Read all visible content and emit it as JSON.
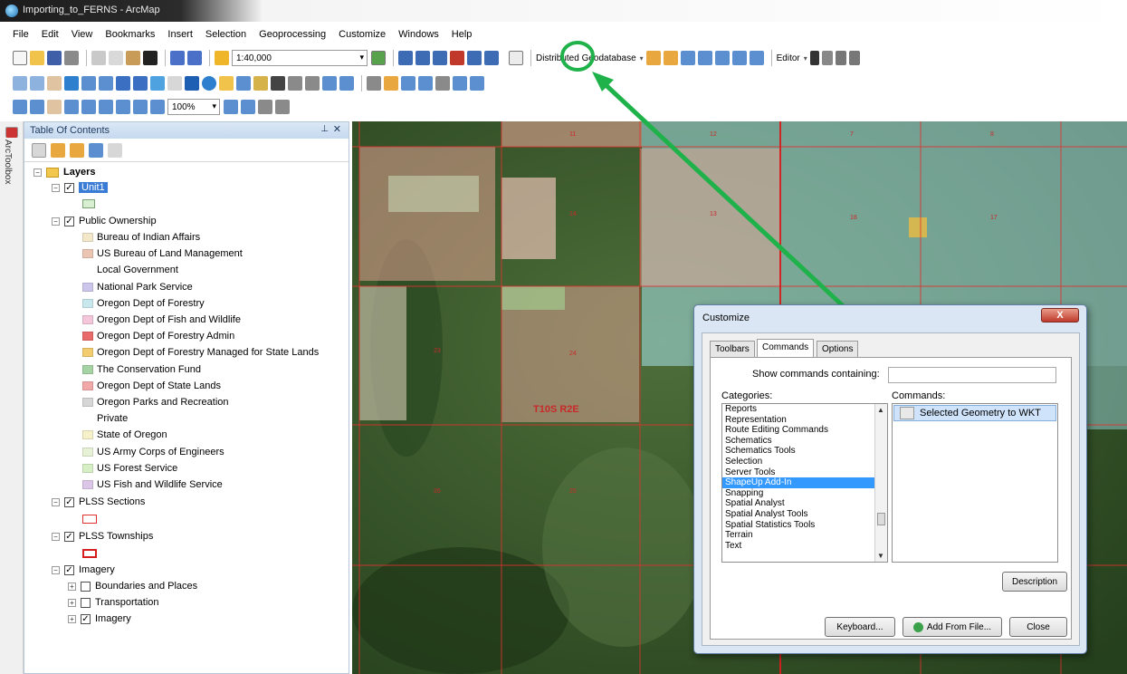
{
  "window": {
    "title": "Importing_to_FERNS - ArcMap"
  },
  "menu": [
    "File",
    "Edit",
    "View",
    "Bookmarks",
    "Insert",
    "Selection",
    "Geoprocessing",
    "Customize",
    "Windows",
    "Help"
  ],
  "toolbar": {
    "scale": "1:40,000",
    "distributed_geodatabase": "Distributed Geodatabase",
    "editor": "Editor",
    "layout_zoom": "100%"
  },
  "sidebar_strip": {
    "label": "ArcToolbox"
  },
  "toc": {
    "title": "Table Of Contents",
    "root": "Layers",
    "layers": [
      {
        "label": "Unit1",
        "selected": true
      },
      {
        "label": "Public Ownership"
      },
      {
        "label": "PLSS Sections"
      },
      {
        "label": "PLSS Townships"
      },
      {
        "label": "Imagery"
      }
    ],
    "public_ownership_classes": [
      {
        "label": "Bureau of Indian Affairs",
        "color": "#f3e7c9"
      },
      {
        "label": "US Bureau of Land Management",
        "color": "#ecc4b2"
      },
      {
        "label": "Local Government",
        "color": ""
      },
      {
        "label": "National Park Service",
        "color": "#cdc6ec"
      },
      {
        "label": "Oregon Dept of Forestry",
        "color": "#c9e8ee"
      },
      {
        "label": "Oregon Dept of Fish and Wildlife",
        "color": "#f3c6d9"
      },
      {
        "label": "Oregon Dept of Forestry Admin",
        "color": "#e86a6a"
      },
      {
        "label": "Oregon Dept of Forestry Managed for State Lands",
        "color": "#f2cc6e"
      },
      {
        "label": "The Conservation Fund",
        "color": "#a6d3a4"
      },
      {
        "label": "Oregon Dept of State Lands",
        "color": "#f2a8a8"
      },
      {
        "label": "Oregon Parks and Recreation",
        "color": "#d6d6d6"
      },
      {
        "label": "Private",
        "color": ""
      },
      {
        "label": "State of Oregon",
        "color": "#f6f1c8"
      },
      {
        "label": "US Army Corps of Engineers",
        "color": "#e7f1d6"
      },
      {
        "label": "US Forest Service",
        "color": "#d7efc4"
      },
      {
        "label": "US Fish and Wildlife Service",
        "color": "#dcc6e8"
      }
    ],
    "imagery_children": [
      {
        "label": "Boundaries and Places",
        "checked": false
      },
      {
        "label": "Transportation",
        "checked": false
      },
      {
        "label": "Imagery",
        "checked": true
      }
    ]
  },
  "map": {
    "township_label": "T10S R2E",
    "section_numbers": [
      "11",
      "12",
      "7",
      "8",
      "14",
      "13",
      "18",
      "17",
      "23",
      "24",
      "26",
      "25"
    ],
    "colors": {
      "blm": "#e3a393",
      "odf": "#a7e2ea",
      "line": "#e0312f",
      "forest": "#3a5a2d"
    }
  },
  "annotation": {
    "color": "#1fb24a"
  },
  "dialog": {
    "title": "Customize",
    "tabs": [
      "Toolbars",
      "Commands",
      "Options"
    ],
    "active_tab": "Commands",
    "show_label": "Show commands containing:",
    "show_value": "",
    "categories_label": "Categories:",
    "commands_label": "Commands:",
    "categories": [
      "Reports",
      "Representation",
      "Route Editing Commands",
      "Schematics",
      "Schematics Tools",
      "Selection",
      "Server Tools",
      "ShapeUp Add-In",
      "Snapping",
      "Spatial Analyst",
      "Spatial Analyst Tools",
      "Spatial Statistics Tools",
      "Terrain",
      "Text"
    ],
    "selected_category": "ShapeUp Add-In",
    "commands": [
      "Selected Geometry to WKT"
    ],
    "buttons": {
      "description": "Description",
      "keyboard": "Keyboard...",
      "add_from_file": "Add From File...",
      "close": "Close",
      "title_close": "X"
    }
  }
}
